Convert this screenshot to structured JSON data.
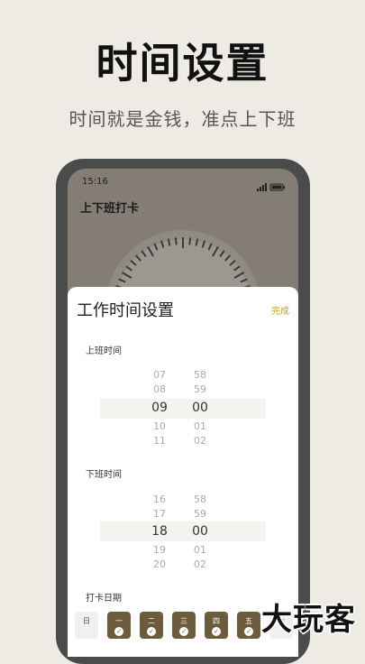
{
  "promo": {
    "headline": "时间设置",
    "subline": "时间就是金钱，准点上下班"
  },
  "device": {
    "status_time": "15:16",
    "app_title": "上下班打卡"
  },
  "sheet": {
    "title": "工作时间设置",
    "done_label": "完成",
    "start_section": {
      "label": "上班时间",
      "hours": [
        "07",
        "08",
        "09",
        "10",
        "11"
      ],
      "minutes": [
        "58",
        "59",
        "00",
        "01",
        "02"
      ]
    },
    "end_section": {
      "label": "下班时间",
      "hours": [
        "16",
        "17",
        "18",
        "19",
        "20"
      ],
      "minutes": [
        "58",
        "59",
        "00",
        "01",
        "02"
      ]
    },
    "days_label": "打卡日期",
    "days": [
      {
        "label": "日",
        "checked": false
      },
      {
        "label": "一",
        "checked": true
      },
      {
        "label": "二",
        "checked": true
      },
      {
        "label": "三",
        "checked": true
      },
      {
        "label": "四",
        "checked": true
      },
      {
        "label": "五",
        "checked": true
      },
      {
        "label": "六",
        "checked": false
      }
    ]
  },
  "watermark": "大玩客",
  "colors": {
    "accent_gold": "#c79a3a",
    "day_brown": "#6d5b3e",
    "background": "#EEEBE5"
  },
  "icons": {
    "check": "check-icon",
    "signal": "signal-icon",
    "battery": "battery-icon"
  }
}
